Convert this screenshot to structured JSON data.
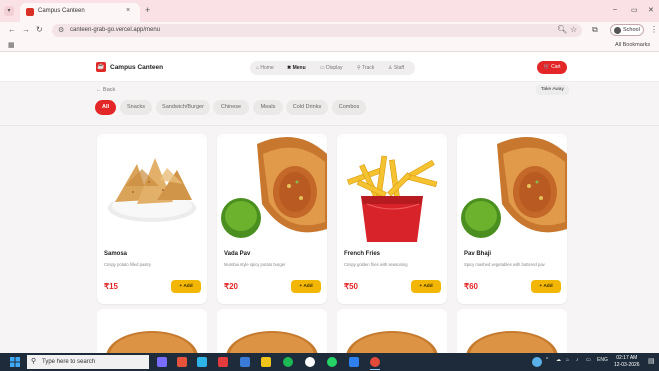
{
  "browser": {
    "tab_title": "Campus Canteen",
    "tab_close": "×",
    "new_tab": "+",
    "url": "canteen-grab-go.vercel.app/menu",
    "profile_label": "School",
    "all_bookmarks": "All Bookmarks",
    "window_controls": {
      "minimize": "–",
      "maximize": "▭",
      "close": "✕"
    }
  },
  "header": {
    "logo_mark": "☕",
    "brand": "Campus Canteen",
    "nav": [
      {
        "label": "⌂ Home"
      },
      {
        "label": "✖ Menu"
      },
      {
        "label": "▭ Display"
      },
      {
        "label": "⚲ Track"
      },
      {
        "label": "♙ Staff"
      }
    ],
    "cart_label": "🛒 Cart"
  },
  "back_label": "← Back",
  "takeaway_label": "Take Away",
  "categories": [
    "All",
    "Snacks",
    "Sandwich/Burger",
    "Chinese",
    "Meals",
    "Cold Drinks",
    "Combos"
  ],
  "active_category": "All",
  "items": [
    {
      "name": "Samosa",
      "desc": "Crispy potato filled pastry",
      "price": "₹15",
      "add": "+ Add",
      "image": "samosa"
    },
    {
      "name": "Vada Pav",
      "desc": "Mumbai style spicy potato burger",
      "price": "₹20",
      "add": "+ Add",
      "image": "roll"
    },
    {
      "name": "French Fries",
      "desc": "Crispy golden fries with seasoning",
      "price": "₹50",
      "add": "+ Add",
      "image": "fries"
    },
    {
      "name": "Pav Bhaji",
      "desc": "Spicy mashed vegetables with buttered pav",
      "price": "₹60",
      "add": "+ Add",
      "image": "roll"
    }
  ],
  "taskbar": {
    "search_placeholder": "Type here to search",
    "tray_lang": "ENG",
    "time": "02:17 AM",
    "date": "12-03-2026"
  },
  "colors": {
    "accent": "#e32626",
    "add_button": "#f2b705",
    "taskbar": "#1d2b3a"
  }
}
